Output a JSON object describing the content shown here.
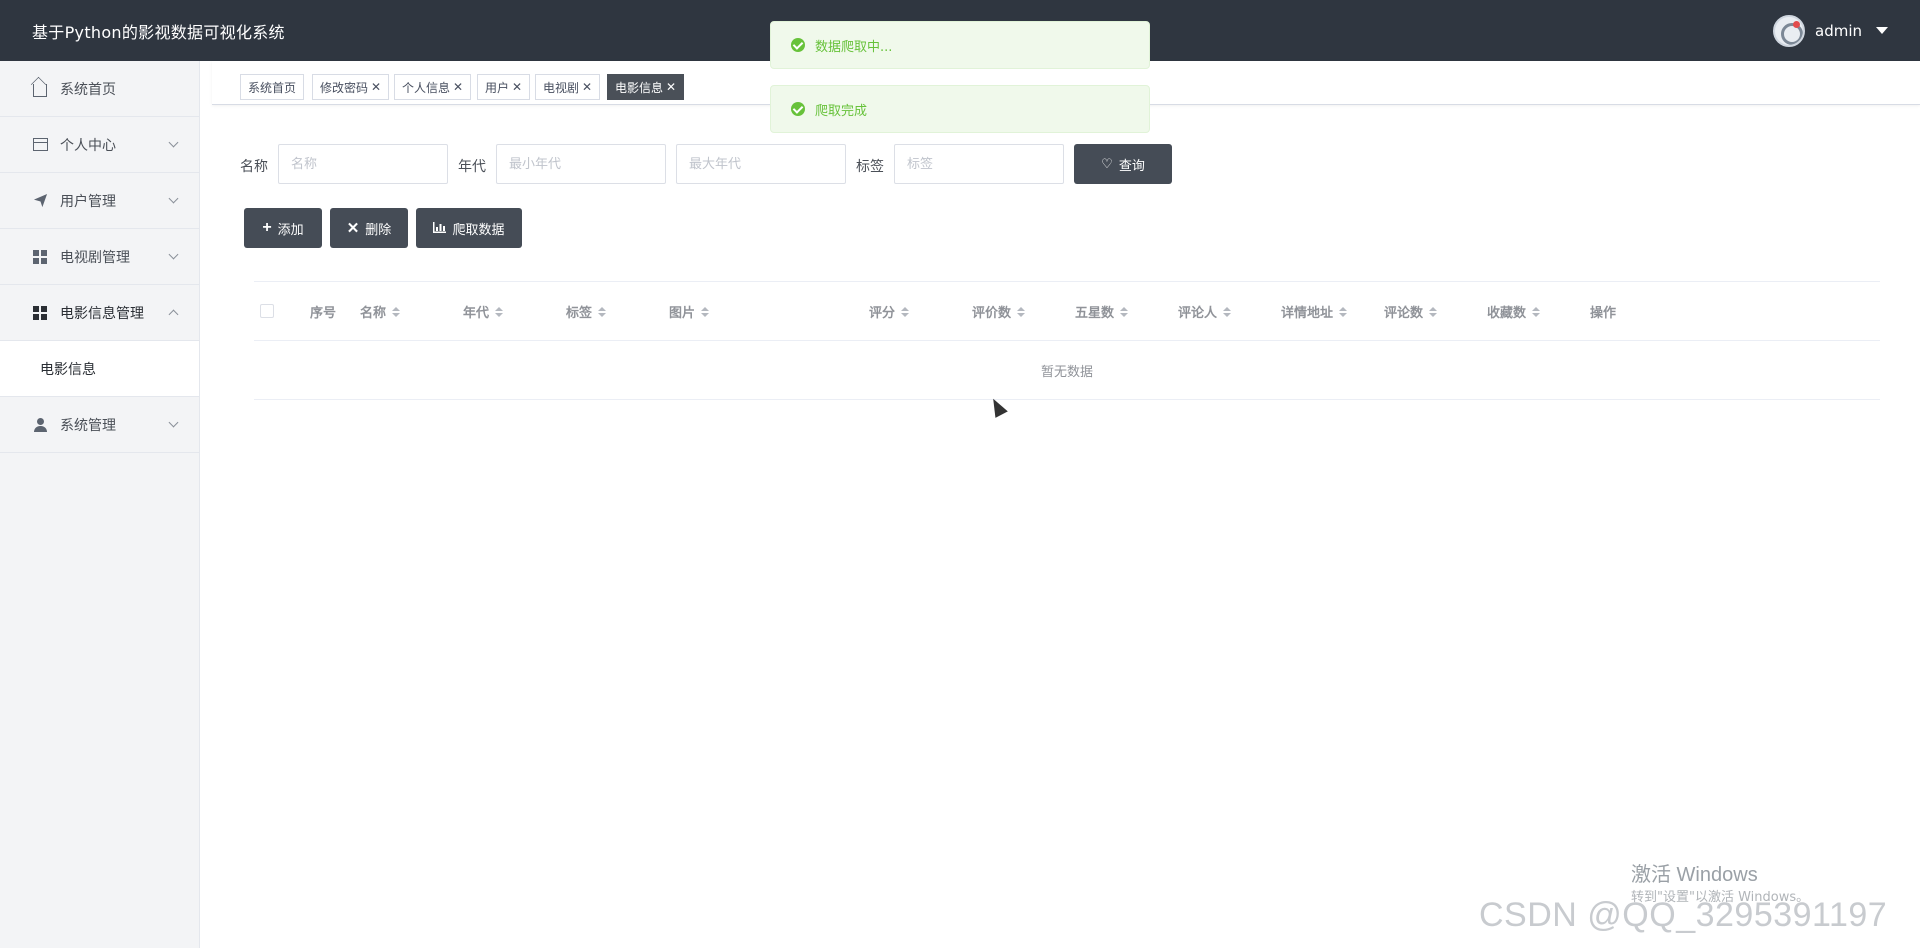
{
  "header": {
    "app_title": "基于Python的影视数据可视化系统",
    "username": "admin"
  },
  "sidebar": {
    "items": [
      {
        "label": "系统首页",
        "icon": "home-icon"
      },
      {
        "label": "个人中心",
        "icon": "card-icon"
      },
      {
        "label": "用户管理",
        "icon": "send-icon"
      },
      {
        "label": "电视剧管理",
        "icon": "grid-icon"
      },
      {
        "label": "电影信息管理",
        "icon": "grid-icon"
      },
      {
        "label": "系统管理",
        "icon": "person-icon"
      }
    ],
    "submenu": {
      "label": "电影信息"
    }
  },
  "tags": [
    {
      "label": "系统首页",
      "closable": false
    },
    {
      "label": "修改密码",
      "closable": true,
      "close": "✕"
    },
    {
      "label": "个人信息",
      "closable": true,
      "close": "✕"
    },
    {
      "label": "用户",
      "closable": true,
      "close": "✕"
    },
    {
      "label": "电视剧",
      "closable": true,
      "close": "✕"
    },
    {
      "label": "电影信息",
      "closable": true,
      "close": "✕",
      "active": true
    }
  ],
  "notifications": [
    {
      "text": "数据爬取中..."
    },
    {
      "text": "爬取完成"
    }
  ],
  "search": {
    "name_label": "名称",
    "name_placeholder": "名称",
    "year_label": "年代",
    "min_year_placeholder": "最小年代",
    "max_year_placeholder": "最大年代",
    "tag_label": "标签",
    "tag_placeholder": "标签",
    "query_button": "查询"
  },
  "actions": {
    "add": "添加",
    "delete": "删除",
    "crawl": "爬取数据"
  },
  "table": {
    "columns": [
      "序号",
      "名称",
      "年代",
      "标签",
      "图片",
      "评分",
      "评价数",
      "五星数",
      "评论人",
      "详情地址",
      "评论数",
      "收藏数",
      "操作"
    ],
    "empty_text": "暂无数据"
  },
  "watermarks": {
    "windows_title": "激活 Windows",
    "windows_sub": "转到\"设置\"以激活 Windows。",
    "csdn": "CSDN @QQ_3295391197"
  },
  "colors": {
    "header_bg": "#2f3640",
    "button_dark": "#454c56",
    "success": "#67c23a",
    "active_tag": "#4a5058"
  }
}
